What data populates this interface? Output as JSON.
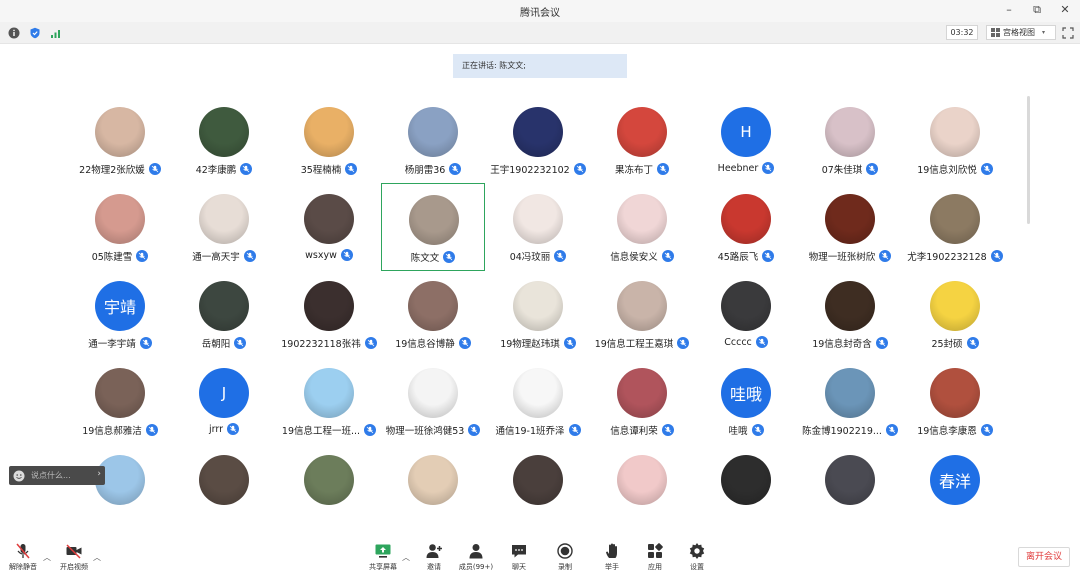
{
  "window": {
    "title": "腾讯会议"
  },
  "infobar": {
    "timer": "03:32",
    "view_label": "宫格视图"
  },
  "speaking": {
    "text": "正在讲话: 陈文文;"
  },
  "chat": {
    "placeholder": "说点什么..."
  },
  "colors": {
    "accent": "#1f6fe5",
    "mic_blue": "#2f7be9",
    "active_border": "#2ea55d",
    "leave_red": "#e03c3c",
    "speaking_bg": "#dde8f6"
  },
  "participants": [
    {
      "name": "22物理2张欣媛",
      "avatar": "photo",
      "color": "#d7b7a3"
    },
    {
      "name": "42李康鹏",
      "avatar": "photo",
      "color": "#3f5a3e"
    },
    {
      "name": "35程楠楠",
      "avatar": "photo",
      "color": "#e9b066"
    },
    {
      "name": "杨朋雷36",
      "avatar": "photo",
      "color": "#8aa1c3"
    },
    {
      "name": "王宇1902232102",
      "avatar": "photo",
      "color": "#28336b"
    },
    {
      "name": "果冻布丁",
      "avatar": "photo",
      "color": "#d4473d"
    },
    {
      "name": "Heebner",
      "avatar": "text",
      "initial": "H",
      "color": "#1f6fe5"
    },
    {
      "name": "07朱佳琪",
      "avatar": "photo",
      "color": "#d8c1c8"
    },
    {
      "name": "19信息刘欣悦",
      "avatar": "photo",
      "color": "#ead3c9"
    },
    {
      "name": "05陈建雪",
      "avatar": "photo",
      "color": "#d59a8f"
    },
    {
      "name": "通一高天宇",
      "avatar": "photo",
      "color": "#e7ddd6"
    },
    {
      "name": "wsxyw",
      "avatar": "photo",
      "color": "#5a4b47"
    },
    {
      "name": "陈文文",
      "avatar": "photo",
      "color": "#a8998c",
      "active": true
    },
    {
      "name": "04冯玟丽",
      "avatar": "photo",
      "color": "#f1e7e3"
    },
    {
      "name": "信息侯安义",
      "avatar": "photo",
      "color": "#f0d6d6"
    },
    {
      "name": "45路辰飞",
      "avatar": "photo",
      "color": "#c9382f"
    },
    {
      "name": "物理一班张树欣",
      "avatar": "photo",
      "color": "#6f2a1c"
    },
    {
      "name": "尤李1902232128",
      "avatar": "photo",
      "color": "#8c7a62"
    },
    {
      "name": "通一李宇靖",
      "avatar": "text",
      "initial": "宇靖",
      "color": "#1f6fe5"
    },
    {
      "name": "岳朝阳",
      "avatar": "photo",
      "color": "#3d4740"
    },
    {
      "name": "1902232118张祎",
      "avatar": "photo",
      "color": "#3b2f2e"
    },
    {
      "name": "19信息谷博静",
      "avatar": "photo",
      "color": "#8d6f66"
    },
    {
      "name": "19物理赵玮琪",
      "avatar": "photo",
      "color": "#e9e4da"
    },
    {
      "name": "19信息工程王嘉琪",
      "avatar": "photo",
      "color": "#c9b4a9"
    },
    {
      "name": "Ccccc",
      "avatar": "photo",
      "color": "#3a3a3c"
    },
    {
      "name": "19信息封奇含",
      "avatar": "photo",
      "color": "#3e2d22"
    },
    {
      "name": "25封硕",
      "avatar": "photo",
      "color": "#f5d342"
    },
    {
      "name": "19信息郝雅洁",
      "avatar": "photo",
      "color": "#7a6258"
    },
    {
      "name": "jrrr",
      "avatar": "text",
      "initial": "J",
      "color": "#1f6fe5"
    },
    {
      "name": "19信息工程一班...",
      "avatar": "photo",
      "color": "#9ccff0"
    },
    {
      "name": "物理一班徐鸿健53",
      "avatar": "photo",
      "color": "#f4f4f4"
    },
    {
      "name": "通信19-1班乔泽",
      "avatar": "photo",
      "color": "#f7f7f7"
    },
    {
      "name": "信息谭利荣",
      "avatar": "photo",
      "color": "#b0545c"
    },
    {
      "name": "哇哦",
      "avatar": "text",
      "initial": "哇哦",
      "color": "#1f6fe5"
    },
    {
      "name": "陈金博1902219...",
      "avatar": "photo",
      "color": "#6b95b8"
    },
    {
      "name": "19信息李康恩",
      "avatar": "photo",
      "color": "#b0503e"
    },
    {
      "avatar": "photo",
      "color": "#9cc6e8"
    },
    {
      "avatar": "photo",
      "color": "#5a4c44"
    },
    {
      "avatar": "photo",
      "color": "#6c7d5b"
    },
    {
      "avatar": "photo",
      "color": "#e3cdb5"
    },
    {
      "avatar": "photo",
      "color": "#4a3f3c"
    },
    {
      "avatar": "photo",
      "color": "#f1c9c9"
    },
    {
      "avatar": "photo",
      "color": "#2d2d2d"
    },
    {
      "avatar": "photo",
      "color": "#4a4a52"
    },
    {
      "avatar": "text",
      "initial": "春洋",
      "color": "#1f6fe5"
    }
  ],
  "toolbar": {
    "unmute": "解除静音",
    "video": "开启视频",
    "share": "共享屏幕",
    "invite": "邀请",
    "members": "成员(99+)",
    "chat": "聊天",
    "record": "录制",
    "raise_hand": "举手",
    "apps": "应用",
    "settings": "设置",
    "leave": "离开会议"
  }
}
